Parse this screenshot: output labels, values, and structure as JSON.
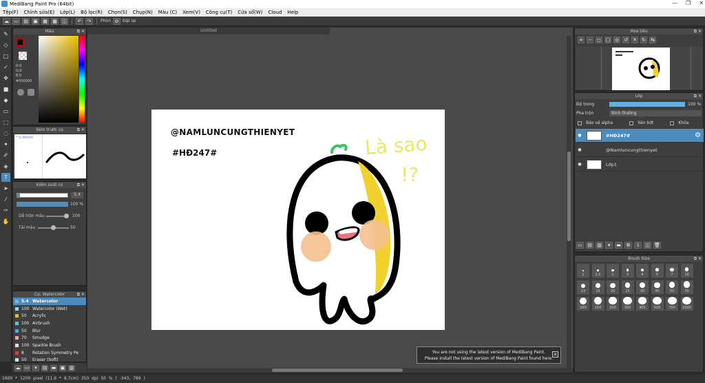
{
  "window": {
    "title": "MediBang Paint Pro (64bit)",
    "controls": [
      "—",
      "❐",
      "✕"
    ]
  },
  "menu": [
    "Tệp(F)",
    "Chỉnh sửa(E)",
    "Lớp(L)",
    "Bộ lọc(R)",
    "Chọn(S)",
    "Chụp(N)",
    "Màu (C)",
    "Xem(V)",
    "Công cụ(T)",
    "Cửa sổ(W)",
    "Cloud",
    "Help"
  ],
  "toolbar": {
    "key_label": "Phím",
    "reset_label": "Đặt lại"
  },
  "color_panel": {
    "title": "Màu",
    "r": "R:0",
    "g": "G:0",
    "b": "B:0",
    "hex": "#000000",
    "fg": "#000000"
  },
  "brush_preview": {
    "title": "Xem trước cọ",
    "size": "* 0.39mm"
  },
  "brush_control": {
    "title": "Kiểm soát cọ",
    "size_value": "5.4",
    "opacity_value": "100 %",
    "blend_label": "Dễ trộn màu",
    "blend_value": "100",
    "reload_label": "Tải màu",
    "reload_value": "50"
  },
  "brush_list": {
    "title": "Cọ: Watercolor",
    "items": [
      {
        "size": "5.4",
        "name": "Watercolor",
        "color": "#7fb0e0",
        "selected": true
      },
      {
        "size": "100",
        "name": "Watercolor (Wet)",
        "color": "#9fd0f0"
      },
      {
        "size": "50",
        "name": "Acrylic",
        "color": "#d0c050"
      },
      {
        "size": "100",
        "name": "Airbrush",
        "color": "#60c0e0"
      },
      {
        "size": "50",
        "name": "Blur",
        "color": "#60a0e0"
      },
      {
        "size": "70",
        "name": "Smudge",
        "color": "#e0b0b0"
      },
      {
        "size": "100",
        "name": "Sparkle Brush",
        "color": "#e0e0e0"
      },
      {
        "size": "8",
        "name": "Rotation Symmetry Pe",
        "color": "#d04040"
      },
      {
        "size": "50",
        "name": "Eraser (Soft)",
        "color": "#e0e0e0"
      }
    ]
  },
  "canvas": {
    "tab": "Untitled",
    "text1": "@NAMLUNCUNGTHIENYET",
    "text2": "#HĐ247#",
    "sign1": "Là sao",
    "sign2": "!?"
  },
  "notification": {
    "line1": "You are not using the latest version of MediBang Paint.",
    "line2": "Please install the latest version of MediBang Paint found here.",
    "close": "✕"
  },
  "navigator": {
    "title": "Hoa tiêu"
  },
  "layer_panel": {
    "title": "Lớp",
    "opacity_label": "Độ trong",
    "opacity_value": "100 %",
    "blend_label": "Pha trộn",
    "blend_value": "Bình thường",
    "protect_alpha": "Bảo vệ alpha",
    "clipping": "Xén bớt",
    "lock": "Khóa",
    "layers": [
      {
        "name": "#HĐ247#",
        "selected": true
      },
      {
        "name": "@Namluncungthienyet",
        "selected": false
      },
      {
        "name": "Lớp1",
        "selected": false
      }
    ]
  },
  "brush_size_panel": {
    "title": "Brush Size",
    "sizes": [
      "1",
      "1.5",
      "2",
      "3",
      "4",
      "5",
      "7",
      "10",
      "13",
      "15",
      "20",
      "25",
      "30",
      "40",
      "50",
      "70",
      "100",
      "150",
      "200",
      "300",
      "400",
      "500",
      "700",
      "1000"
    ]
  },
  "status": {
    "text": "1600 * 1200 pixel   (11.6 * 8.7cm)   350 dpi   50 %   ( -343, 789 )"
  }
}
